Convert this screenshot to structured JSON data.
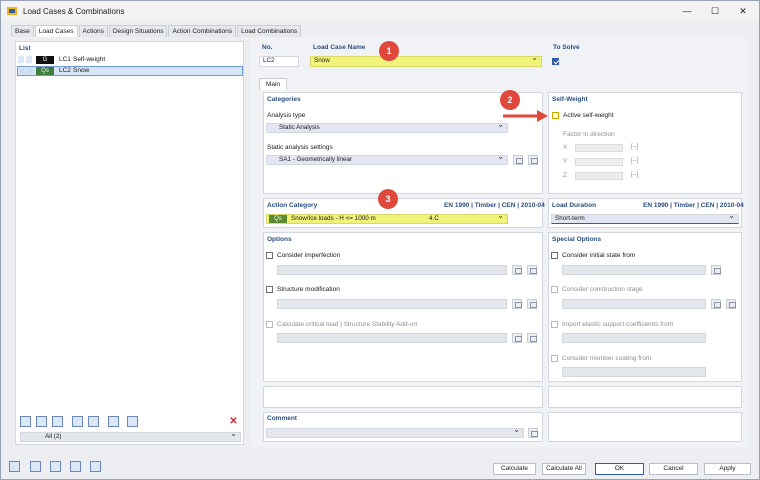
{
  "window": {
    "title": "Load Cases & Combinations"
  },
  "tabs": [
    "Base",
    "Load Cases",
    "Actions",
    "Design Situations",
    "Action Combinations",
    "Load Combinations"
  ],
  "list": {
    "title": "List",
    "items": [
      {
        "badge": "G",
        "badge_color": "#111111",
        "id": "LC1",
        "name": "Self-weight"
      },
      {
        "badge": "Qs",
        "badge_color": "#3b7d3a",
        "id": "LC2",
        "name": "Snow"
      }
    ],
    "filter": "All (2)"
  },
  "header": {
    "no_label": "No.",
    "no_value": "LC2",
    "name_label": "Load Case Name",
    "name_value": "Snow",
    "to_solve_label": "To Solve"
  },
  "subtab": "Main",
  "categories": {
    "title": "Categories",
    "analysis_type_label": "Analysis type",
    "analysis_type_value": "Static Analysis",
    "settings_label": "Static analysis settings",
    "settings_value": "SA1 - Geometrically linear"
  },
  "self_weight": {
    "title": "Self-Weight",
    "active_label": "Active self-weight",
    "factor_label": "Factor in direction",
    "axes": [
      "X",
      "Y",
      "Z"
    ],
    "unit": "[--]"
  },
  "action_category": {
    "title": "Action Category",
    "norm": "EN 1990 | Timber | CEN | 2010-04",
    "badge": "Qs",
    "value": "Snow/Ice loads - H <= 1000 m",
    "code": "4.C"
  },
  "load_duration": {
    "title": "Load Duration",
    "norm": "EN 1990 | Timber | CEN | 2010-04",
    "value": "Short-term"
  },
  "options": {
    "title": "Options",
    "items": [
      "Consider imperfection",
      "Structure modification",
      "Calculate critical load | Structure Stability Add-on"
    ]
  },
  "special_options": {
    "title": "Special Options",
    "items": [
      "Consider initial state from",
      "Consider construction stage",
      "Import elastic support coefficients from",
      "Consider member coating from"
    ]
  },
  "comment": {
    "title": "Comment"
  },
  "markers": [
    "1",
    "2",
    "3"
  ],
  "buttons": {
    "calculate": "Calculate",
    "calculate_all": "Calculate All",
    "ok": "OK",
    "cancel": "Cancel",
    "apply": "Apply"
  },
  "colors": {
    "accent": "#2f5da8",
    "highlight": "#f1f27a",
    "marker": "#e0483c",
    "section_title": "#2b4e7e"
  }
}
